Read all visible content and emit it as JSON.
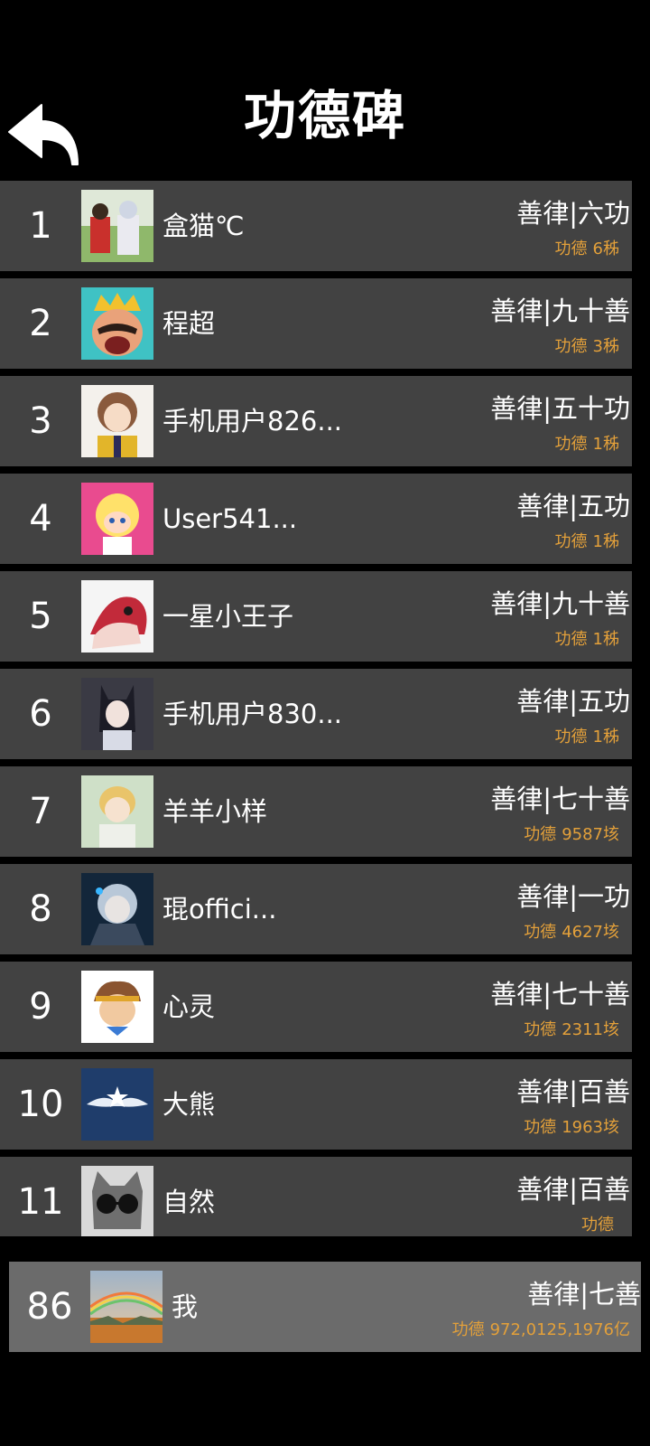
{
  "header": {
    "title": "功德碑",
    "back_icon": "back-arrow-icon"
  },
  "colors": {
    "background": "#000000",
    "row_background": "#424242",
    "my_row_background": "#6b6b6b",
    "merit_text": "#e3a03a"
  },
  "merit_label": "功德",
  "leaderboard": [
    {
      "rank": "1",
      "name": "盒猫℃",
      "level": "善律|六功",
      "merit": "6秭"
    },
    {
      "rank": "2",
      "name": "程超",
      "level": "善律|九十善",
      "merit": "3秭"
    },
    {
      "rank": "3",
      "name": "手机用户826...",
      "level": "善律|五十功",
      "merit": "1秭"
    },
    {
      "rank": "4",
      "name": "User541...",
      "level": "善律|五功",
      "merit": "1秭"
    },
    {
      "rank": "5",
      "name": "一星小王子",
      "level": "善律|九十善",
      "merit": "1秭"
    },
    {
      "rank": "6",
      "name": "手机用户830...",
      "level": "善律|五功",
      "merit": "1秭"
    },
    {
      "rank": "7",
      "name": "羊羊小样",
      "level": "善律|七十善",
      "merit": "9587垓"
    },
    {
      "rank": "8",
      "name": "琨offici...",
      "level": "善律|一功",
      "merit": "4627垓"
    },
    {
      "rank": "9",
      "name": "心灵",
      "level": "善律|七十善",
      "merit": "2311垓"
    },
    {
      "rank": "10",
      "name": "大熊",
      "level": "善律|百善",
      "merit": "1963垓"
    },
    {
      "rank": "11",
      "name": "自然",
      "level": "善律|百善",
      "merit": ""
    }
  ],
  "my_entry": {
    "rank": "86",
    "name": "我",
    "level": "善律|七善",
    "merit": "972,0125,1976亿"
  }
}
